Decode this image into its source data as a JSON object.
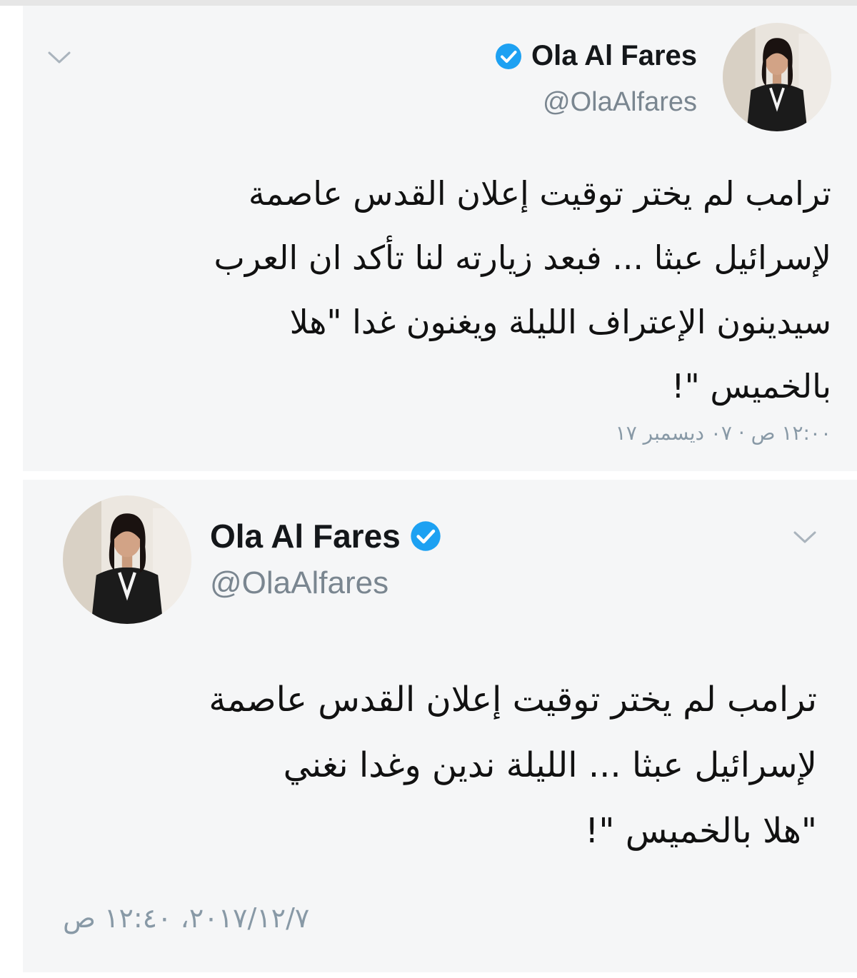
{
  "tweets": [
    {
      "display_name": "Ola Al Fares",
      "handle": "@OlaAlfares",
      "avatar_icon": "profile-photo",
      "verified_icon": "verified-badge-icon",
      "menu_icon": "chevron-down-icon",
      "text": "ترامب لم يختر توقيت إعلان القدس عاصمة\nلإسرائيل عبثا ... فبعد زيارته لنا تأكد ان العرب\nسيدينون الإعتراف الليلة  ويغنون غدا \"هلا\nبالخميس \"!",
      "timestamp": "١٢:٠٠ ص · ٠٧ ديسمبر ١٧"
    },
    {
      "display_name": "Ola Al Fares",
      "handle": "@OlaAlfares",
      "avatar_icon": "profile-photo",
      "verified_icon": "verified-badge-icon",
      "menu_icon": "chevron-down-icon",
      "text": "ترامب لم يختر توقيت إعلان القدس عاصمة\nلإسرائيل عبثا ... الليلة  ندين وغدا نغني\n\"هلا بالخميس \"!",
      "timestamp": "٢٠١٧/١٢/٧، ١٢:٤٠ ص"
    }
  ],
  "colors": {
    "background": "#f5f6f7",
    "name": "#14171a",
    "handle": "#7a8690",
    "verified": "#1da1f2",
    "timestamp": "#8899a6"
  }
}
